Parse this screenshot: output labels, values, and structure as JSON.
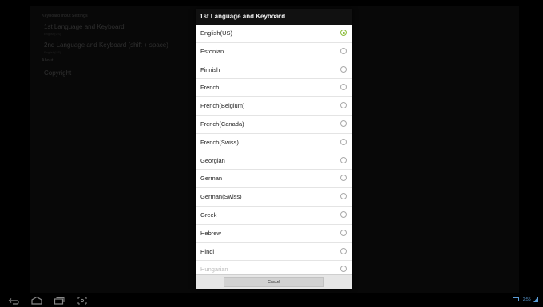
{
  "background": {
    "section_keyboard": "Keyboard Input Settings",
    "item1_title": "1st Language and Keyboard",
    "item1_sub": "English(US)",
    "item2_title": "2nd Language and Keyboard (shift + space)",
    "item2_sub": "English(US)",
    "section_about": "About",
    "copyright": "Copyright"
  },
  "dialog": {
    "title": "1st Language and Keyboard",
    "items": [
      {
        "label": "English(US)",
        "selected": true
      },
      {
        "label": "Estonian",
        "selected": false
      },
      {
        "label": "Finnish",
        "selected": false
      },
      {
        "label": "French",
        "selected": false
      },
      {
        "label": "French(Belgium)",
        "selected": false
      },
      {
        "label": "French(Canada)",
        "selected": false
      },
      {
        "label": "French(Swiss)",
        "selected": false
      },
      {
        "label": "Georgian",
        "selected": false
      },
      {
        "label": "German",
        "selected": false
      },
      {
        "label": "German(Swiss)",
        "selected": false
      },
      {
        "label": "Greek",
        "selected": false
      },
      {
        "label": "Hebrew",
        "selected": false
      },
      {
        "label": "Hindi",
        "selected": false
      },
      {
        "label": "Hungarian",
        "selected": false
      }
    ],
    "cancel_label": "Cancel"
  },
  "nav": {
    "icons": [
      "back-icon",
      "home-icon",
      "recent-apps-icon",
      "screenshot-icon"
    ]
  },
  "status": {
    "time": "2:55"
  },
  "colors": {
    "radio_selected": "#8bbd3a",
    "status_text": "#5b9cd6"
  }
}
